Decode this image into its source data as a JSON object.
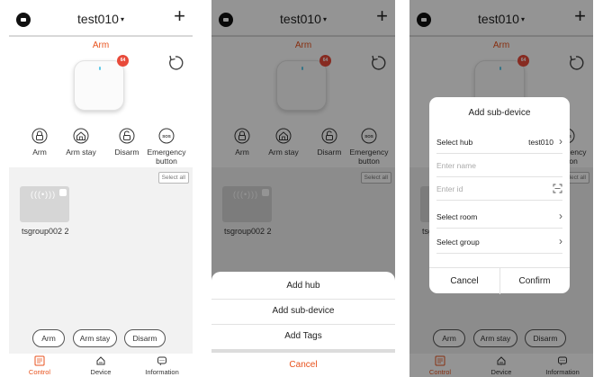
{
  "header": {
    "hub_name": "test010",
    "caret": "▾",
    "add_symbol": "+"
  },
  "status": {
    "arm_text": "Arm",
    "badge": "64"
  },
  "actions": [
    {
      "icon": "arm-icon",
      "label": "Arm"
    },
    {
      "icon": "arm-stay-icon",
      "label": "Arm stay"
    },
    {
      "icon": "disarm-icon",
      "label": "Disarm"
    },
    {
      "icon": "sos-icon",
      "label": "Emergency button",
      "icon_text": "SOS"
    }
  ],
  "list": {
    "select_all": "Select all",
    "device": {
      "card_label": "(((•)))",
      "name": "tsgroup002 2"
    }
  },
  "bottom_buttons": [
    "Arm",
    "Arm stay",
    "Disarm"
  ],
  "tabs": [
    {
      "icon": "control-icon",
      "label": "Control",
      "active": true
    },
    {
      "icon": "device-icon",
      "label": "Device",
      "active": false
    },
    {
      "icon": "information-icon",
      "label": "Information",
      "active": false
    }
  ],
  "action_sheet": {
    "items": [
      "Add hub",
      "Add sub-device",
      "Add Tags"
    ],
    "cancel": "Cancel"
  },
  "dialog": {
    "title": "Add sub-device",
    "select_hub_label": "Select hub",
    "select_hub_value": "test010",
    "name_placeholder": "Enter name",
    "id_placeholder": "Enter id",
    "select_room_label": "Select room",
    "select_group_label": "Select group",
    "chevron": "›",
    "cancel": "Cancel",
    "confirm": "Confirm"
  },
  "colors": {
    "accent": "#e8521d",
    "badge": "#e84a3a"
  }
}
